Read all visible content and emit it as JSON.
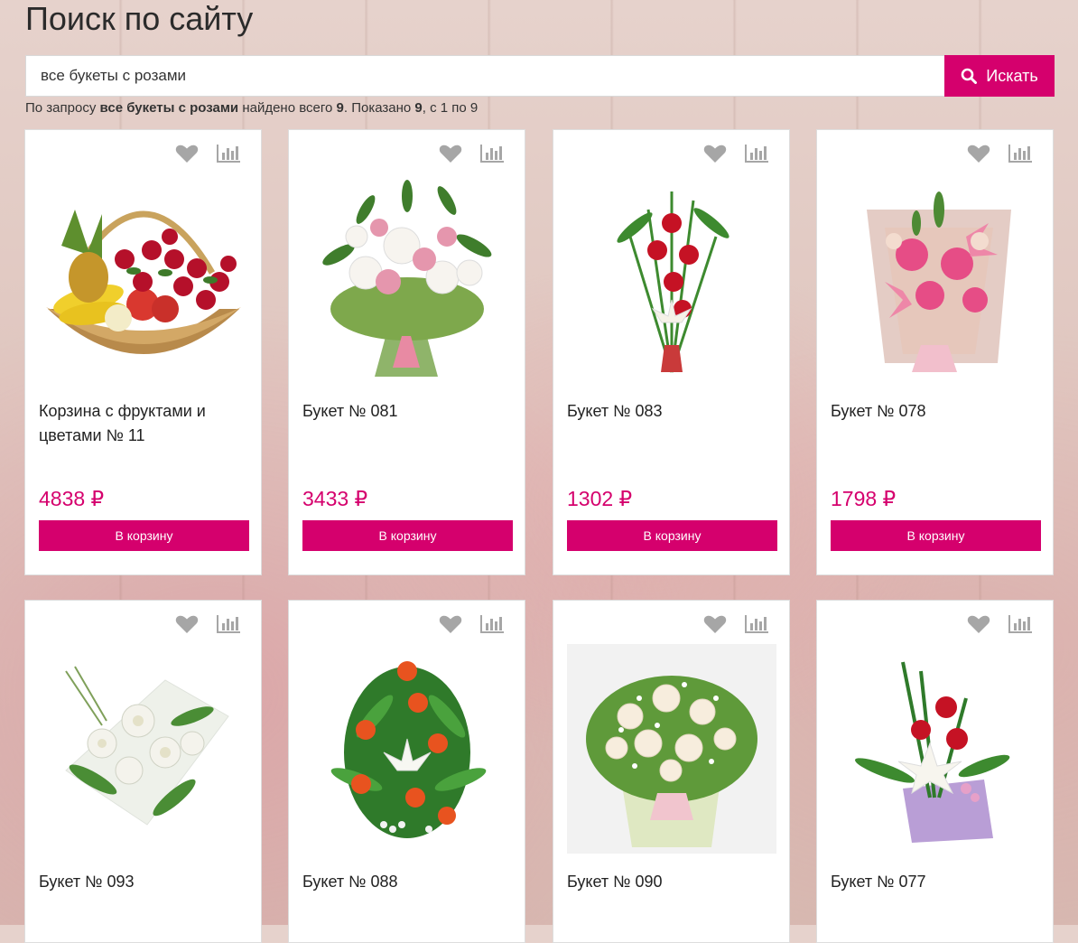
{
  "page": {
    "title": "Поиск по сайту"
  },
  "search": {
    "value": "все букеты с розами",
    "button_label": "Искать",
    "summary": {
      "prefix": "По запросу",
      "query": "все букеты с розами",
      "found_text": "найдено всего",
      "total": "9",
      "shown_text": ". Показано",
      "shown": "9",
      "range_text": ", с 1 по 9"
    }
  },
  "colors": {
    "accent": "#d5006d",
    "icon_gray": "#a6a6a6"
  },
  "products": [
    {
      "name": "Корзина с фруктами и цветами № 11",
      "price": "4838 ₽",
      "cart_label": "В корзину"
    },
    {
      "name": "Букет № 081",
      "price": "3433 ₽",
      "cart_label": "В корзину"
    },
    {
      "name": "Букет № 083",
      "price": "1302 ₽",
      "cart_label": "В корзину"
    },
    {
      "name": "Букет № 078",
      "price": "1798 ₽",
      "cart_label": "В корзину"
    },
    {
      "name": "Букет № 093"
    },
    {
      "name": "Букет № 088"
    },
    {
      "name": "Букет № 090"
    },
    {
      "name": "Букет № 077"
    }
  ]
}
